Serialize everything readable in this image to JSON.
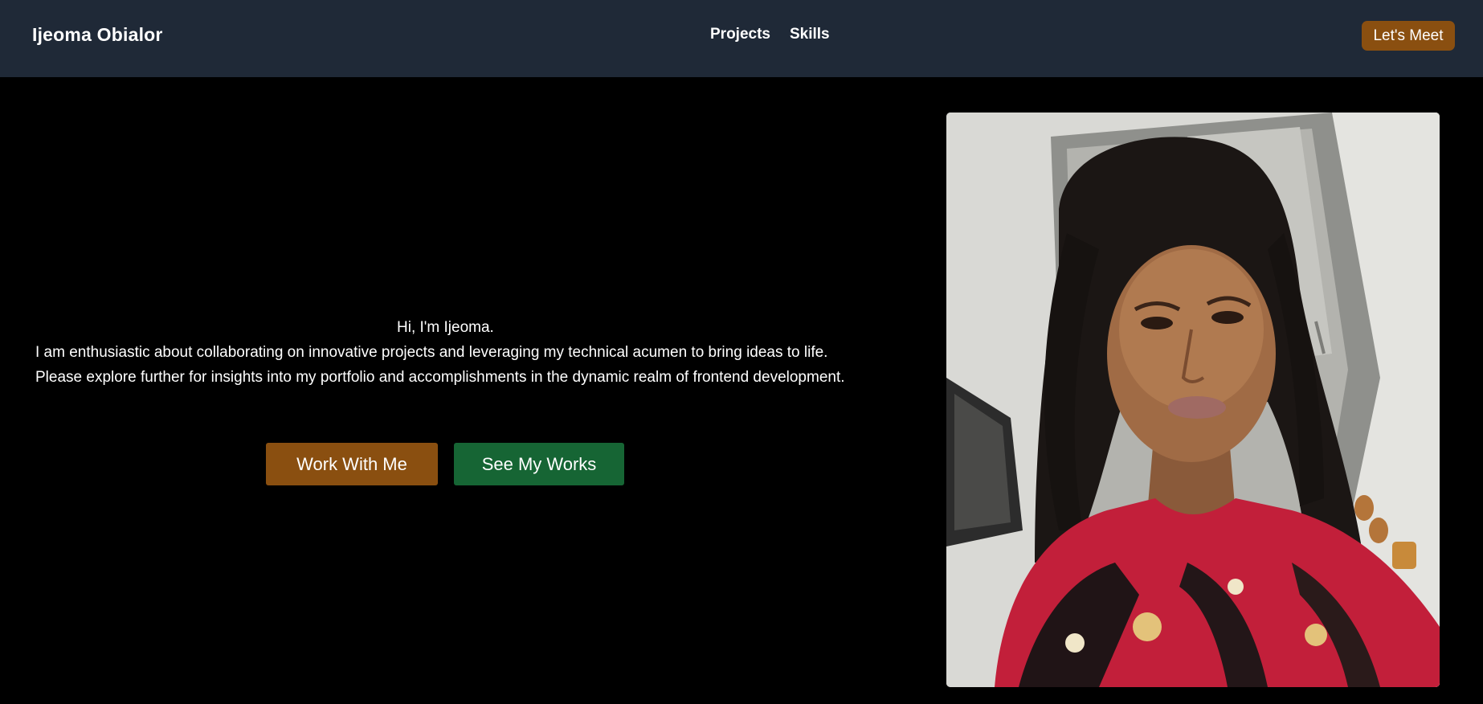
{
  "navbar": {
    "brand": "Ijeoma Obialor",
    "links": [
      {
        "label": "Projects"
      },
      {
        "label": "Skills"
      }
    ],
    "cta_label": "Let's Meet"
  },
  "hero": {
    "greeting": "Hi, I'm Ijeoma.",
    "intro": "I am enthusiastic about collaborating on innovative projects and leveraging my technical acumen to bring ideas to life. Please explore further for insights into my portfolio and accomplishments in the dynamic realm of frontend development.",
    "primary_button": "Work With Me",
    "secondary_button": "See My Works"
  },
  "colors": {
    "navbar_bg": "#1f2937",
    "page_bg": "#000000",
    "accent_brown": "#8a4f10",
    "accent_green": "#166534"
  }
}
